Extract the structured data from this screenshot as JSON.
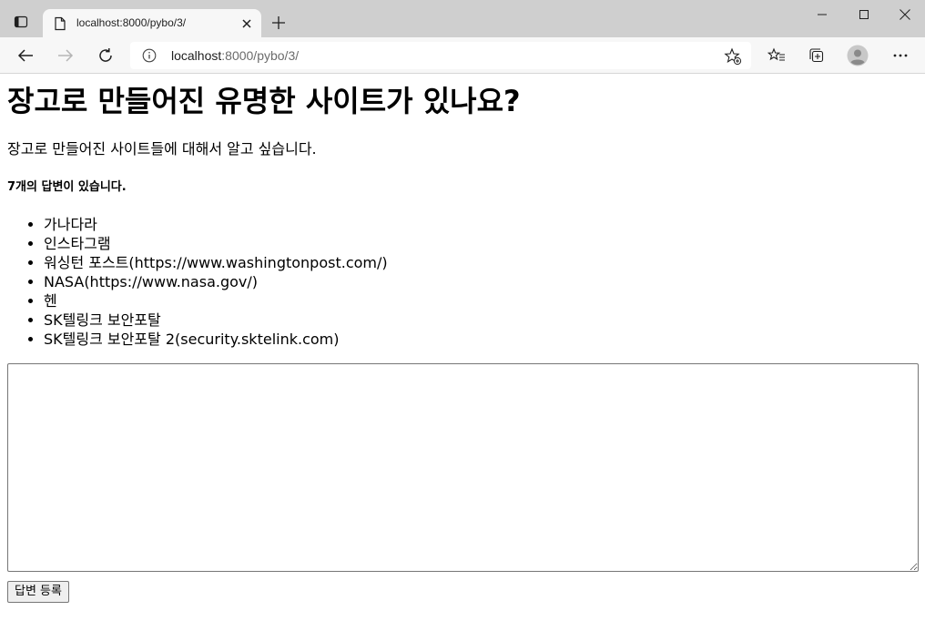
{
  "browser": {
    "tab": {
      "title": "localhost:8000/pybo/3/",
      "favicon": "page-icon"
    },
    "address_bar": {
      "host": "localhost",
      "path": ":8000/pybo/3/"
    },
    "icons": {
      "tab_actions": "tab-actions-icon",
      "new_tab": "plus-icon",
      "back": "back-arrow-icon",
      "forward": "forward-arrow-icon",
      "reload": "reload-icon",
      "info": "info-icon",
      "add_favorite": "star-plus-icon",
      "favorites": "favorites-icon",
      "collections": "collections-icon",
      "profile": "profile-avatar-icon",
      "more": "more-dots-icon"
    },
    "colors": {
      "tabstrip": "#cfcfcf",
      "toolbar": "#f7f7f7"
    }
  },
  "question": {
    "subject": "장고로 만들어진 유명한 사이트가 있나요?",
    "content": "장고로 만들어진 사이트들에 대해서 알고 싶습니다."
  },
  "answers": {
    "count_text": "7개의 답변이 있습니다.",
    "items": [
      "가나다라",
      "인스타그램",
      "워싱턴 포스트(https://www.washingtonpost.com/)",
      "NASA(https://www.nasa.gov/)",
      "헨",
      "SK텔링크 보안포탈",
      "SK텔링크 보안포탈 2(security.sktelink.com)"
    ]
  },
  "answer_form": {
    "textarea_value": "",
    "submit_label": "답변 등록"
  }
}
